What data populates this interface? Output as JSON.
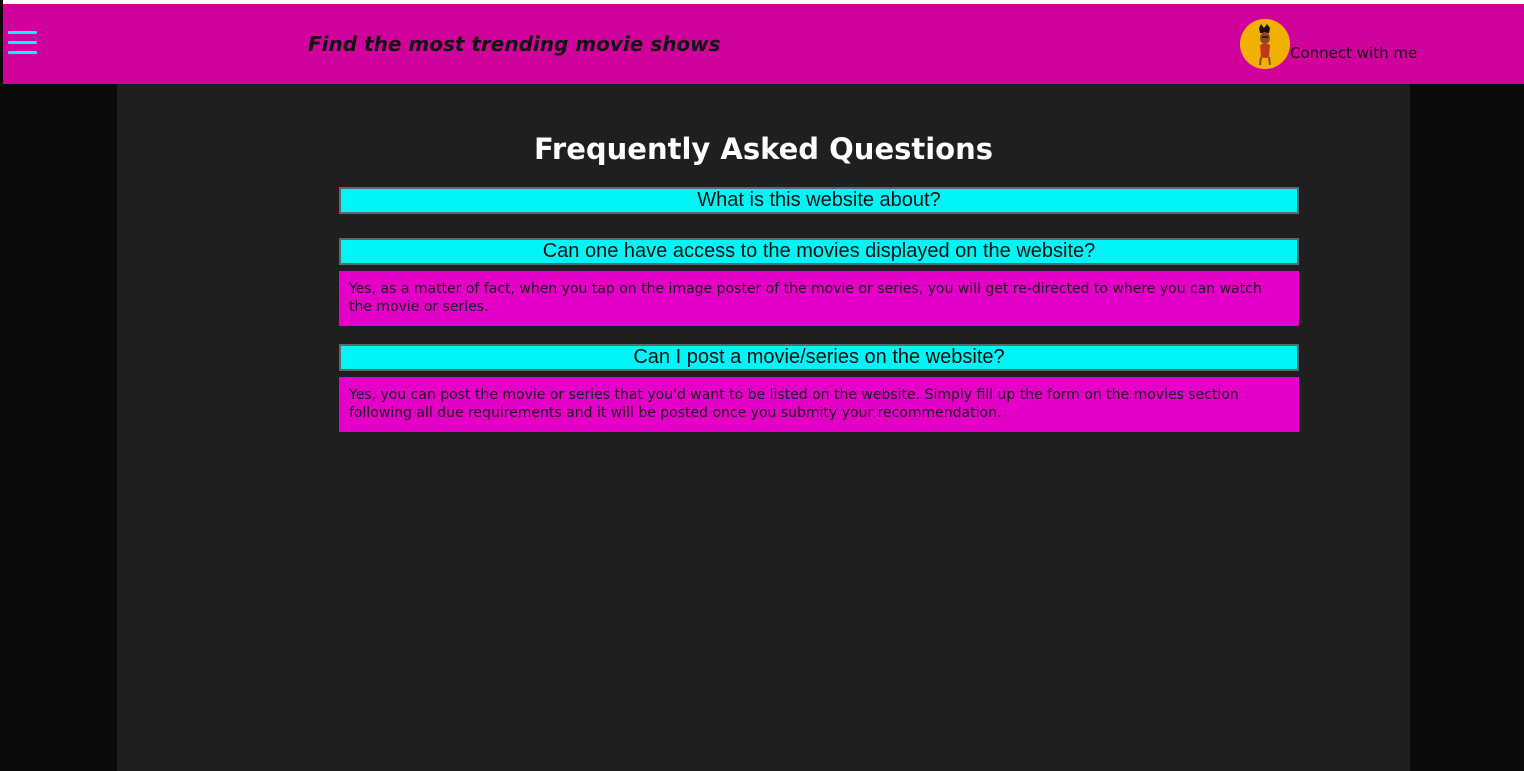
{
  "header": {
    "menu_icon": "hamburger-icon",
    "tagline": "Find the most trending movie shows",
    "avatar_icon": "avatar-illustration",
    "connect_label": "Connect with me"
  },
  "faq": {
    "title": "Frequently Asked Questions",
    "items": [
      {
        "question": "What is this website about?",
        "answer": ""
      },
      {
        "question": "Can one have access to the movies displayed on the website?",
        "answer": "Yes, as a matter of fact, when you tap on the image poster of the movie or series, you will get re-directed to where you can watch the movie or series."
      },
      {
        "question": "Can I post a movie/series on the website?",
        "answer": "Yes, you can post the movie or series that you'd want to be listed on the website. Simply fill up the form on the movies section following all due requirements and it will be posted once you submity your recommendation."
      }
    ]
  },
  "colors": {
    "header_bg": "#d1019c",
    "question_bg": "#00f5f7",
    "answer_bg": "#e500c8",
    "main_bg": "#1f1f1f",
    "side_bg": "#0b0b0b",
    "avatar_bg": "#f2b100"
  }
}
